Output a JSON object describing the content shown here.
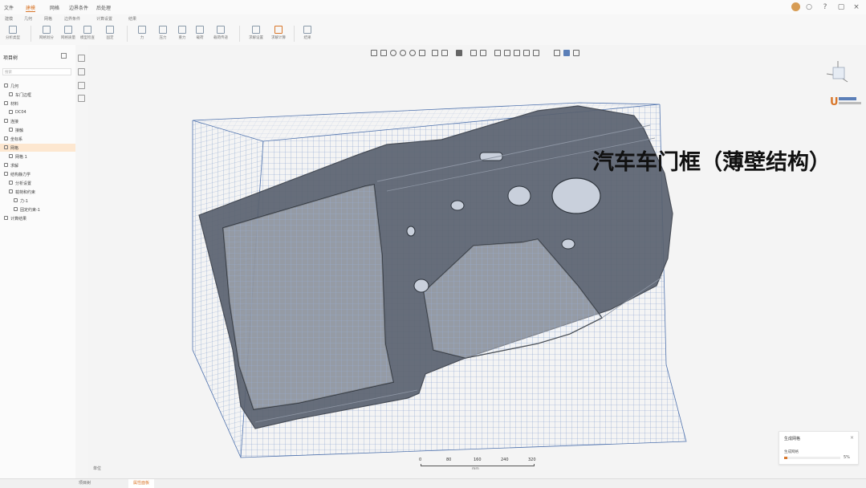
{
  "menu": {
    "items": [
      "文件",
      "建模",
      "网格",
      "边界条件",
      "后处理"
    ],
    "active_index": 1,
    "window_icons": [
      "bell-icon",
      "help-icon",
      "expand-icon",
      "close-icon"
    ]
  },
  "ribbon": {
    "tabs": [
      "建模",
      "几何",
      "网格",
      "边界条件",
      "计算设置",
      "结果"
    ],
    "buttons": [
      "分析类型",
      "网格划分",
      "网格质量",
      "模型检查",
      "固定",
      "力",
      "压力",
      "重力",
      "载荷",
      "载荷传递",
      "求解设置",
      "求解计算",
      "结果"
    ]
  },
  "left_panel": {
    "title": "项目树",
    "search_placeholder": "搜索",
    "rows": [
      {
        "label": "几何",
        "right": "",
        "indent": 0,
        "selected": false
      },
      {
        "label": "车门边框",
        "right": "",
        "indent": 1,
        "selected": false
      },
      {
        "label": "材料",
        "right": "",
        "indent": 0,
        "selected": false
      },
      {
        "label": "DC04",
        "right": "",
        "indent": 1,
        "selected": false
      },
      {
        "label": "连接",
        "right": "",
        "indent": 0,
        "selected": false
      },
      {
        "label": "接触",
        "right": "",
        "indent": 1,
        "selected": false
      },
      {
        "label": "坐标系",
        "right": "",
        "indent": 0,
        "selected": false
      },
      {
        "label": "网格",
        "right": "",
        "indent": 0,
        "selected": true
      },
      {
        "label": "网格 1",
        "right": "",
        "indent": 1,
        "selected": false
      },
      {
        "label": "求解",
        "right": "",
        "indent": 0,
        "selected": false
      },
      {
        "label": "结构静力学",
        "right": "",
        "indent": 0,
        "selected": false
      },
      {
        "label": "分析设置",
        "right": "",
        "indent": 1,
        "selected": false
      },
      {
        "label": "载荷和约束",
        "right": "",
        "indent": 1,
        "selected": false
      },
      {
        "label": "力-1",
        "right": "",
        "indent": 2,
        "selected": false
      },
      {
        "label": "固定约束-1",
        "right": "",
        "indent": 2,
        "selected": false
      },
      {
        "label": "计算结果",
        "right": "",
        "indent": 0,
        "selected": false
      }
    ]
  },
  "viewport": {
    "overlay_title": "汽车车门框（薄壁结构）",
    "bottom_left_label": "单位",
    "scale_ticks": [
      "0",
      "80",
      "160",
      "240",
      "320"
    ],
    "scale_unit": "mm"
  },
  "progress_card": {
    "title": "生成网格",
    "label": "生成网格",
    "percent_text": "5%",
    "progress": 0.05
  },
  "bottom_tabs": [
    "项目树",
    "属性面板"
  ],
  "colors": {
    "accent": "#d9772b",
    "mesh_blue": "#6d8fc4",
    "part_gray": "#5a6270"
  }
}
